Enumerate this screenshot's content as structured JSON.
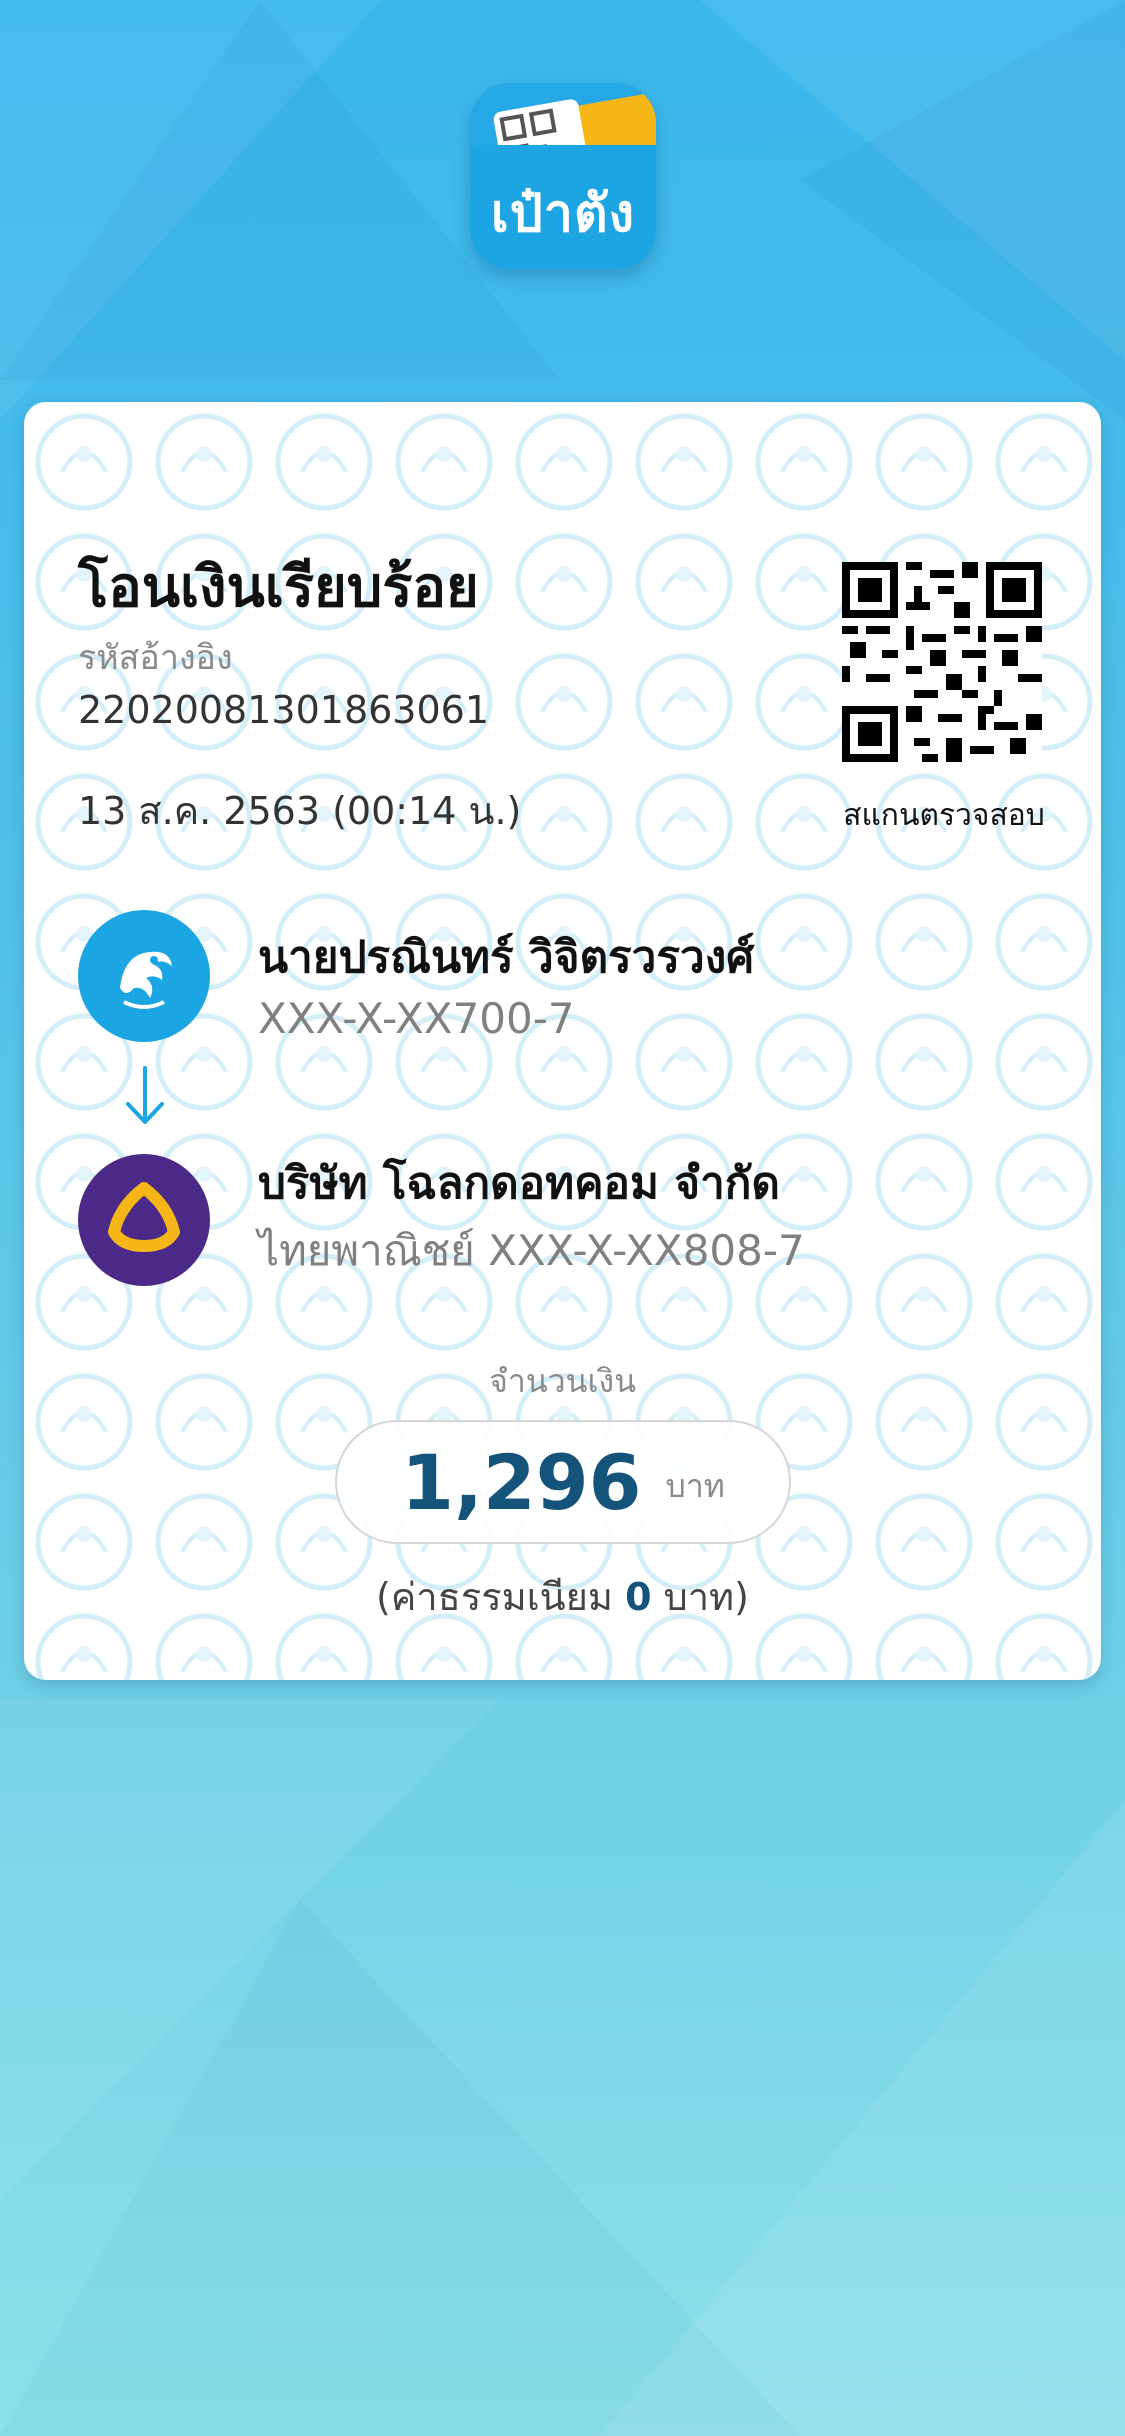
{
  "app": {
    "icon_label": "เป๋าตัง"
  },
  "receipt": {
    "title": "โอนเงินเรียบร้อย",
    "ref_label": "รหัสอ้างอิง",
    "ref_value": "22020081301863061",
    "date": "13 ส.ค. 2563 (00:14 น.)",
    "qr_label": "สแกนตรวจสอบ",
    "sender": {
      "name": "นายปรณินทร์ วิจิตรวรวงศ์",
      "account": "XXX-X-XX700-7"
    },
    "receiver": {
      "name": "บริษัท โฉลกดอทคอม จำกัด",
      "account": "ไทยพาณิชย์ XXX-X-XX808-7"
    },
    "amount_label": "จำนวนเงิน",
    "amount_value": "1,296",
    "amount_unit": "บาท",
    "fee_prefix": "(ค่าธรรมเนียม ",
    "fee_value": "0",
    "fee_suffix": " บาท)"
  },
  "colors": {
    "background_top": "#3bb7ec",
    "background_bottom": "#8ee0ea",
    "amount": "#14537a",
    "sender_bank": "#1ba6e3",
    "receiver_bank": "#4a2a86",
    "receiver_bank_emblem": "#f6b618"
  },
  "icons": {
    "sender_logo": "krungthai-bank-logo",
    "receiver_logo": "scb-bank-logo",
    "arrow": "arrow-down-icon",
    "qr": "qr-code-icon"
  }
}
